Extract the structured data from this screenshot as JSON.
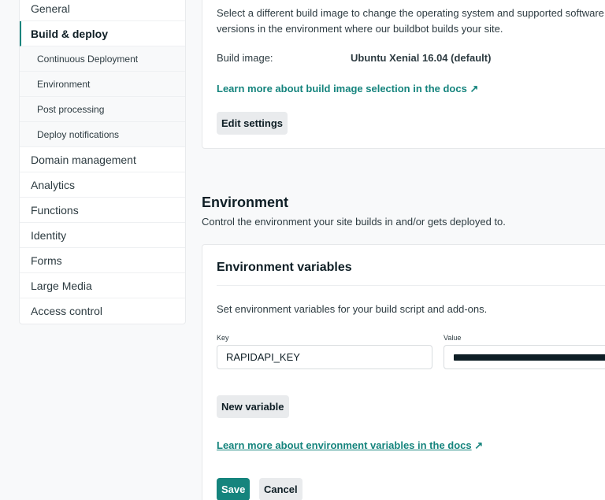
{
  "sidebar": {
    "items": [
      {
        "label": "General"
      },
      {
        "label": "Build & deploy",
        "active": true
      },
      {
        "label": "Continuous Deployment",
        "sub": true
      },
      {
        "label": "Environment",
        "sub": true
      },
      {
        "label": "Post processing",
        "sub": true
      },
      {
        "label": "Deploy notifications",
        "sub": true
      },
      {
        "label": "Domain management"
      },
      {
        "label": "Analytics"
      },
      {
        "label": "Functions"
      },
      {
        "label": "Identity"
      },
      {
        "label": "Forms"
      },
      {
        "label": "Large Media"
      },
      {
        "label": "Access control"
      }
    ]
  },
  "build_image_card": {
    "description_line1": "Select a different build image to change the operating system and supported software",
    "description_line2": "versions in the environment where our buildbot builds your site.",
    "build_image_label": "Build image:",
    "build_image_value": "Ubuntu Xenial 16.04 (default)",
    "docs_link": "Learn more about build image selection in the docs ↗",
    "edit_button": "Edit settings"
  },
  "environment": {
    "title": "Environment",
    "description": "Control the environment your site builds in and/or gets deployed to.",
    "card": {
      "title": "Environment variables",
      "description": "Set environment variables for your build script and add-ons.",
      "key_label": "Key",
      "value_label": "Value",
      "key_value": "RAPIDAPI_KEY",
      "new_variable_button": "New variable",
      "docs_link": "Learn more about environment variables in the docs",
      "docs_link_arrow": "↗",
      "save_button": "Save",
      "cancel_button": "Cancel"
    }
  },
  "colors": {
    "accent": "#15847d",
    "text": "#2d3b41",
    "background": "#f8f9fa"
  }
}
